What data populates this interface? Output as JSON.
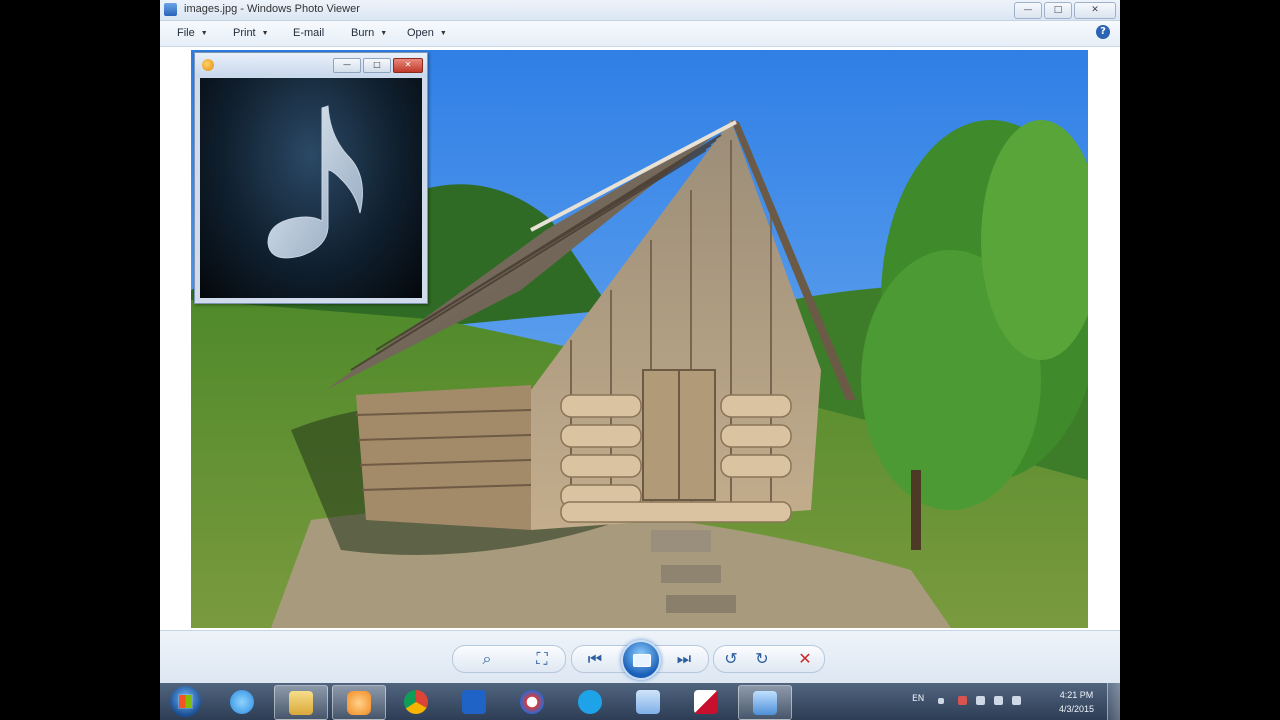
{
  "window": {
    "title": "images.jpg - Windows Photo Viewer",
    "controls": {
      "minimize": "—",
      "maximize": "□",
      "close": "✕"
    }
  },
  "menubar": {
    "items": [
      {
        "label": "File",
        "has_arrow": true
      },
      {
        "label": "Print",
        "has_arrow": true
      },
      {
        "label": "E-mail",
        "has_arrow": false
      },
      {
        "label": "Burn",
        "has_arrow": true
      },
      {
        "label": "Open",
        "has_arrow": true
      }
    ],
    "help_icon": "?"
  },
  "photo": {
    "subject": "log-cabin-landscape"
  },
  "media_player": {
    "icon": "media-player-icon",
    "art_icon": "music-note-icon",
    "controls": {
      "minimize": "—",
      "maximize": "□",
      "close": "✕"
    }
  },
  "toolbar": {
    "zoom": "⌕",
    "actual_size": "⛶",
    "previous": "⏮",
    "next": "⏭",
    "rotate_ccw": "↺",
    "rotate_cw": "↻",
    "delete": "✕"
  },
  "taskbar": {
    "pinned": [
      {
        "name": "internet-explorer-icon",
        "color": "#2a8be0"
      },
      {
        "name": "file-explorer-icon",
        "color": "#e8c25a"
      },
      {
        "name": "media-player-icon",
        "color": "#f28a22"
      },
      {
        "name": "chrome-icon",
        "color": "#3aa757"
      },
      {
        "name": "app-h-icon",
        "color": "#1f63c6"
      },
      {
        "name": "app-swirl-icon",
        "color": "#d83b3b"
      },
      {
        "name": "skype-icon",
        "color": "#1fa3e8"
      },
      {
        "name": "app-chat-icon",
        "color": "#7fb0e8"
      },
      {
        "name": "kaspersky-icon",
        "color": "#c8102e"
      },
      {
        "name": "photo-viewer-icon",
        "color": "#4e8fd8"
      }
    ],
    "tray": {
      "language": "EN"
    },
    "clock": {
      "time": "4:21 PM",
      "date": "4/3/2015"
    }
  }
}
